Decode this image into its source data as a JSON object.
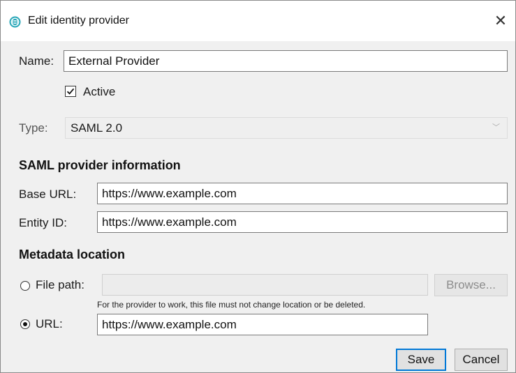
{
  "window": {
    "title": "Edit identity provider"
  },
  "form": {
    "name_label": "Name:",
    "name_value": "External Provider",
    "active_label": "Active",
    "active_checked": true,
    "type_label": "Type:",
    "type_value": "SAML 2.0"
  },
  "saml": {
    "heading": "SAML provider information",
    "base_url_label": "Base URL:",
    "base_url_value": "https://www.example.com",
    "entity_id_label": "Entity ID:",
    "entity_id_value": "https://www.example.com"
  },
  "metadata": {
    "heading": "Metadata location",
    "file_path_label": "File path:",
    "file_path_value": "",
    "browse_label": "Browse...",
    "hint": "For the provider to work, this file must not change location or be deleted.",
    "url_label": "URL:",
    "url_value": "https://www.example.com",
    "selected_option": "URL:"
  },
  "buttons": {
    "save": "Save",
    "cancel": "Cancel"
  },
  "colors": {
    "default_button_border": "#0078d7",
    "app_icon": "#2aa7b8"
  }
}
